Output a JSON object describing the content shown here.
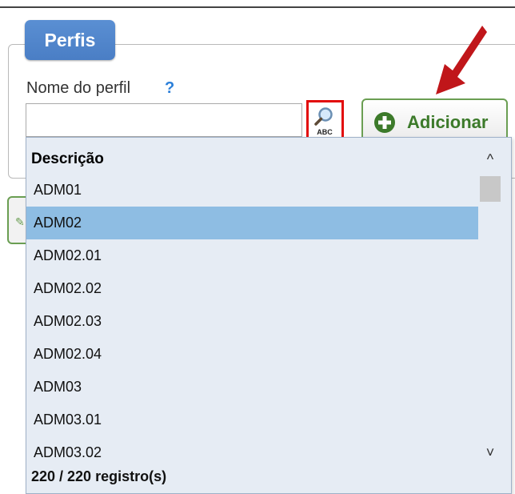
{
  "panel": {
    "legend": "Perfis",
    "field_label": "Nome do perfil",
    "help_mark": "?"
  },
  "name_input": {
    "value": "",
    "placeholder": ""
  },
  "search_button": {
    "icon": "search-abc-icon",
    "caption": "ABC"
  },
  "add_button": {
    "label": "Adicionar",
    "icon": "plus-circle-icon",
    "color": "#3c7a2a"
  },
  "dropdown": {
    "header": "Descrição",
    "items": [
      {
        "label": "ADM01",
        "selected": false
      },
      {
        "label": "ADM02",
        "selected": true
      },
      {
        "label": "ADM02.01",
        "selected": false
      },
      {
        "label": "ADM02.02",
        "selected": false
      },
      {
        "label": "ADM02.03",
        "selected": false
      },
      {
        "label": "ADM02.04",
        "selected": false
      },
      {
        "label": "ADM03",
        "selected": false
      },
      {
        "label": "ADM03.01",
        "selected": false
      },
      {
        "label": "ADM03.02",
        "selected": false
      }
    ],
    "footer": "220 / 220 registro(s)",
    "selected_color": "#8ebde3"
  },
  "colors": {
    "legend_bg": "#4a7ec5",
    "highlight": "#e20b0b",
    "arrow": "#c0161a"
  }
}
